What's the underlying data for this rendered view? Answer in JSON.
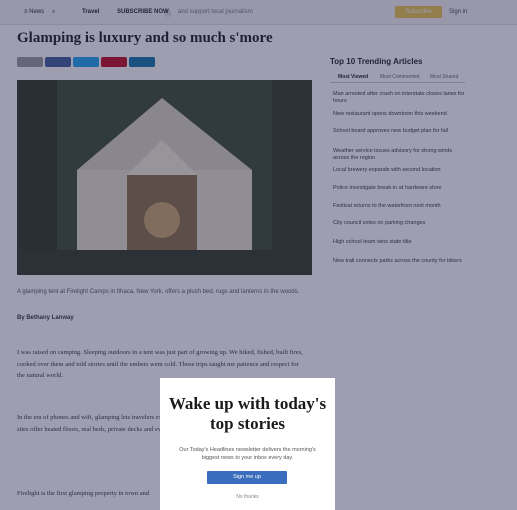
{
  "colors": {
    "accent": "#3a6dbd",
    "subscribe": "#e9c54a",
    "overlay": "#28285a"
  },
  "topbar": {
    "menu_icon": "menu-icon",
    "news_label": "≡ News",
    "search_icon": "search-icon",
    "travel_label": "Travel",
    "promo_label": "SUBSCRIBE NOW",
    "promo_sub": "and support local journalism",
    "subscribe_label": "Subscribe",
    "signin_label": "Sign in"
  },
  "article": {
    "title": "Glamping is luxury and so much s'more",
    "caption": "A glamping tent at Firelight Camps in Ithaca, New York, offers a plush bed, rugs and lanterns in the woods.",
    "byline": "By Bethany Lanway",
    "paragraphs": [
      "I was raised on camping. Sleeping outdoors in a tent was just part of growing up. We hiked, fished, built fires, cooked over them and told stories until the embers went cold. Those trips taught me patience and respect for the natural world.",
      "In the era of phones and wifi, glamping lets travelers experience the outdoors without giving up comfort. Some sites offer heated floors, real beds, private decks and even chef-prepared meals under the stars.",
      "Firelight is the first glamping property in town and"
    ]
  },
  "sidebar": {
    "title": "Top 10 Trending Articles",
    "tabs": [
      "Most Viewed",
      "Most Commented",
      "Most Shared"
    ],
    "items": [
      "Man arrested after crash on interstate closes lanes for hours",
      "New restaurant opens downtown this weekend",
      "School board approves new budget plan for fall",
      "Weather service issues advisory for strong winds across the region",
      "Local brewery expands with second location",
      "Police investigate break-in at hardware store",
      "Festival returns to the waterfront next month",
      "City council votes on parking changes",
      "High school team wins state title",
      "New trail connects parks across the county for bikers"
    ]
  },
  "modal": {
    "headline": "Wake up with today's top stories",
    "description": "Our Today's Headlines newsletter delivers the morning's biggest news to your inbox every day.",
    "cta_label": "Sign me up",
    "dismiss_label": "No thanks"
  }
}
